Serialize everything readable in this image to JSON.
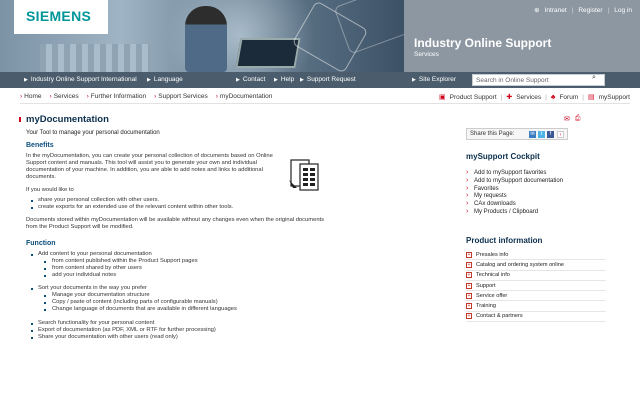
{
  "header": {
    "logo": "SIEMENS",
    "top_links": [
      "Intranet",
      "Register",
      "Log in"
    ],
    "site_title": "Industry Online Support",
    "site_subtitle": "Services"
  },
  "navbar": {
    "items": [
      "Industry Online Support International",
      "Language",
      "Contact",
      "Help",
      "Support Request",
      "Site Explorer"
    ],
    "search_placeholder": "Search in Online Support"
  },
  "breadcrumb": [
    "Home",
    "Services",
    "Further Information",
    "Support Services",
    "myDocumentation"
  ],
  "quick_links": [
    "Product Support",
    "Services",
    "Forum",
    "mySupport"
  ],
  "main": {
    "title": "myDocumentation",
    "lead": "Your Tool to manage your personal documentation",
    "benefits_heading": "Benefits",
    "benefits_text": "In the myDocumentation, you can create your personal collection of documents based on Online Support content and manuals. This tool will assist you to generate your own and individual documentation of your machine. In addition, you are able to add notes and links to additional documents.",
    "if_you_like": "If you would like to",
    "benefits_list": [
      "share your personal collection with other users.",
      "create exports for an extended use of the relevant content within other tools."
    ],
    "availability": "Documents stored within myDocumentation will be available without any changes even when the original documents from the Product Support will be modified.",
    "function_heading": "Function",
    "function_add": "Add content to your personal documentation",
    "function_add_sub": [
      "from content published within the Product Support pages",
      "from content shared by other users",
      "add your individual notes"
    ],
    "function_sort": "Sort your documents in the way you prefer",
    "function_sort_sub": [
      "Manage your documentation structure",
      "Copy / paste of content (including parts of configurable manuals)",
      "Change language of documents that are available in different languages"
    ],
    "function_more": [
      "Search functionality for your personal content",
      "Export of documentation (as PDF, XML or RTF for further processing)",
      "Share your documentation with other users (read only)"
    ]
  },
  "side": {
    "share_label": "Share this Page:",
    "cockpit_title": "mySupport Cockpit",
    "cockpit_links": [
      "Add to mySupport favorites",
      "Add to mySupport documentation",
      "Favorites",
      "My requests",
      "CAx downloads",
      "My Products / Clipboard"
    ],
    "product_info_title": "Product information",
    "product_info": [
      "Presales info",
      "Catalog and ordering system online",
      "Technical info",
      "Support",
      "Service offer",
      "Training",
      "Contact & partners"
    ]
  },
  "colors": {
    "brand": "#00969a",
    "accent": "#d0021b",
    "nav": "#4b5d6d",
    "heading": "#0b2f4d"
  }
}
